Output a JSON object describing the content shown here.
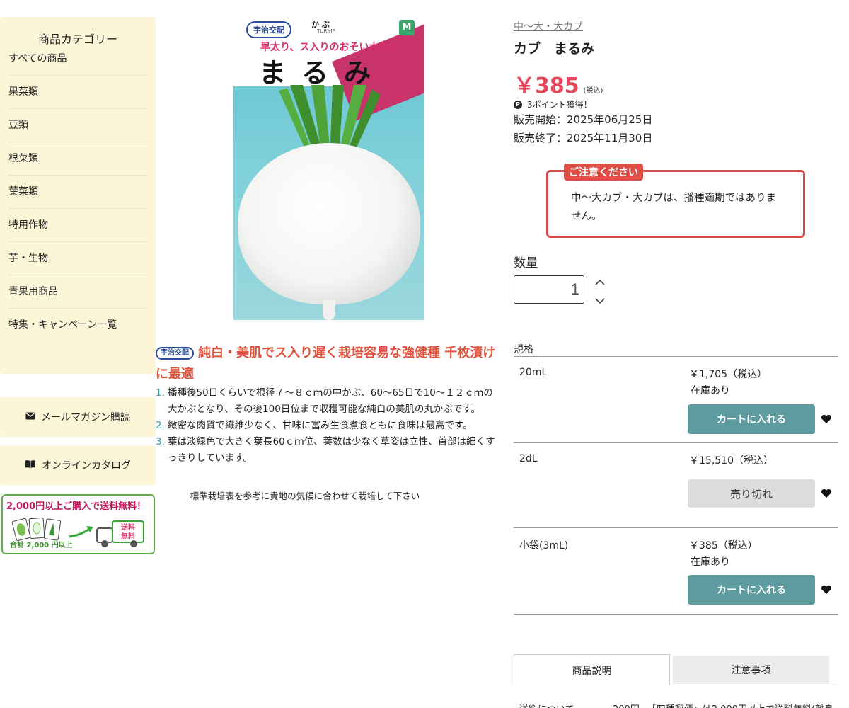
{
  "sidebar": {
    "title": "商品カテゴリー",
    "items": [
      {
        "label": "すべての商品"
      },
      {
        "label": "果菜類"
      },
      {
        "label": "豆類"
      },
      {
        "label": "根菜類"
      },
      {
        "label": "葉菜類"
      },
      {
        "label": "特用作物"
      },
      {
        "label": "芋・生物"
      },
      {
        "label": "青果用商品"
      },
      {
        "label": "特集・キャンペーン一覧"
      }
    ],
    "mail_button": {
      "label": "メールマガジン購読",
      "icon": "envelope-icon"
    },
    "catalog_button": {
      "label": "オンラインカタログ",
      "icon": "book-open-icon"
    },
    "shipping_banner": {
      "amount": "2,000",
      "headline_rest": "円以上ご購入で送料無料！",
      "sub": "合計 2,000 円以上",
      "truck_text": "送料無料"
    }
  },
  "product_image": {
    "brand": "宇治交配",
    "kabu": "か ぶ",
    "turnip": "TURNIP",
    "logo": "M",
    "tagline": "早太り、ス入りのおそい大かぶ",
    "name": "まるみ"
  },
  "description": {
    "brand": "宇治交配",
    "heading": "純白・美肌でス入り遅く栽培容易な強健種 千枚漬けに最適",
    "points": [
      {
        "num": "1.",
        "text": "播種後50日くらいで根径７～８ｃｍの中かぶ、60～65日で10～１２ｃｍの大かぶとなり、その後100日位まで収穫可能な純白の美肌の丸かぶです。"
      },
      {
        "num": "2.",
        "text": "緻密な肉質で繊維少なく、甘味に富み生食煮食ともに食味は最高です。"
      },
      {
        "num": "3.",
        "text": "葉は淡緑色で大きく葉長60ｃｍ位、葉数は少なく草姿は立性、首部は細くすっきりしています。"
      }
    ],
    "note": "標準栽培表を参考に貴地の気候に合わせて栽培して下さい"
  },
  "product": {
    "category_link": "中〜大・大カブ",
    "title": "カブ　まるみ",
    "price": "￥385",
    "tax_label": "(税込)",
    "points": "3ポイント獲得！",
    "sale_start": "販売開始：2025年06月25日",
    "sale_end": "販売終了：2025年11月30日",
    "notice": {
      "tag": "ご注意ください",
      "text": "中〜大カブ・大カブは、播種適期ではありません。"
    },
    "quantity": {
      "label": "数量",
      "value": "1"
    },
    "spec_header": "規格",
    "variants": [
      {
        "name": "20mL",
        "price": "￥1,705（税込）",
        "stock": "在庫あり",
        "button": "カートに入れる"
      },
      {
        "name": "2dL",
        "price": "￥15,510（税込）",
        "stock": "",
        "button": "売り切れ"
      },
      {
        "name": "小袋(3mL)",
        "price": "￥385（税込）",
        "stock": "在庫あり",
        "button": "カートに入れる"
      }
    ],
    "tabs": [
      {
        "label": "商品説明"
      },
      {
        "label": "注意事項"
      }
    ],
    "shipping_row": {
      "label": "送料について",
      "value": "200円~「四種郵便」は2,000円以上で送料無料(離島"
    }
  },
  "colors": {
    "accent_price": "#e8455a",
    "cart_button": "#5d9b9e",
    "notice_border": "#d84a4a",
    "sidebar_bg": "#fdf5d8",
    "heading_red": "#e0533d"
  }
}
